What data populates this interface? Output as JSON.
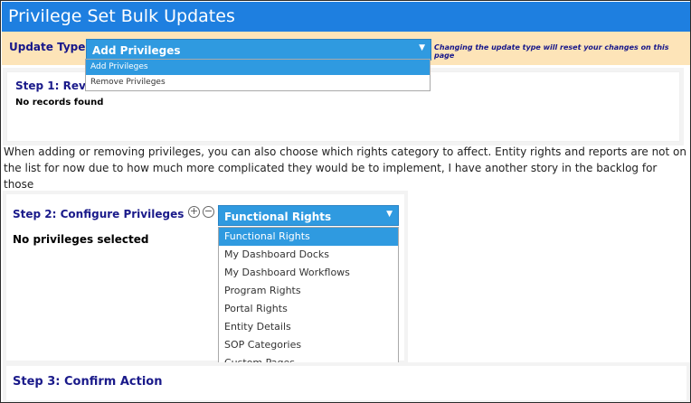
{
  "title": "Privilege Set Bulk Updates",
  "update_type": {
    "label": "Update Type:",
    "selected": "Add Privileges",
    "hint": "Changing the update type will reset your changes on this page",
    "options": [
      "Add Privileges",
      "Remove Privileges"
    ]
  },
  "step1": {
    "title": "Step 1: Review",
    "empty": "No records found"
  },
  "note": "When adding or removing privileges, you can also choose which rights category to affect. Entity rights and reports are not on the list for now due to how much more complicated they would be to implement, I have another story in the backlog for those",
  "step2": {
    "title": "Step 2: Configure Privileges",
    "empty": "No privileges selected",
    "rights_select": {
      "selected": "Functional Rights",
      "options": [
        "Functional Rights",
        "My Dashboard Docks",
        "My Dashboard Workflows",
        "Program Rights",
        "Portal Rights",
        "Entity Details",
        "SOP Categories",
        "Custom Pages"
      ]
    }
  },
  "step3": {
    "title": "Step 3: Confirm Action"
  },
  "colors": {
    "titlebar": "#1e7fe0",
    "band": "#fde4b8",
    "select": "#2f9ae0",
    "heading": "#1a1a8a"
  },
  "icons": {
    "caret": "chevron-down-icon",
    "add": "plus-circle-icon",
    "remove": "minus-circle-icon"
  }
}
